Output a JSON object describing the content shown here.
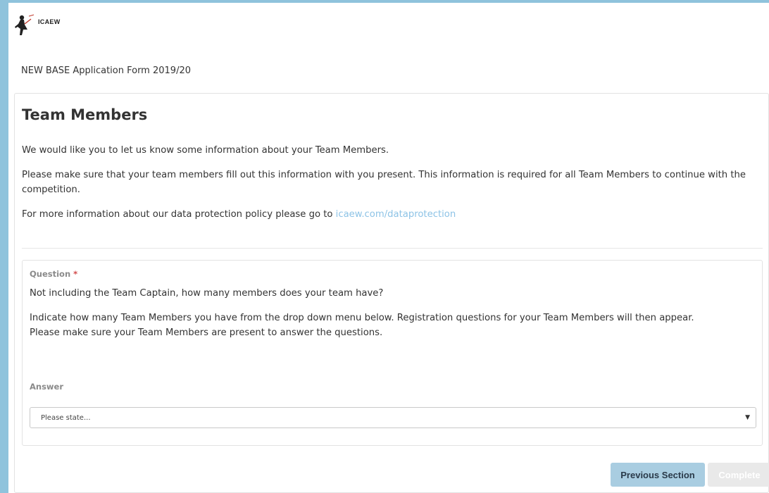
{
  "header": {
    "logo_text": "ICAEW",
    "form_title": "NEW BASE Application Form 2019/20"
  },
  "section": {
    "heading": "Team Members",
    "intro_1": "We would like you to let us know some information about your Team Members.",
    "intro_2": "Please make sure that your team members fill out this information with you present. This information is required for all Team Members to continue with the competition.",
    "intro_3_prefix": "For more information about our data protection policy please go to ",
    "intro_3_link": "icaew.com/dataprotection"
  },
  "question": {
    "label": "Question",
    "required_mark": "*",
    "text_1": "Not including the Team Captain, how many members does your team have?",
    "text_2": "Indicate how many Team Members you have from the drop down menu below. Registration questions for your Team Members will then appear.",
    "text_3": "Please make sure your Team Members are present to answer the questions.",
    "answer_label": "Answer",
    "select_value": "Please state...",
    "select_icon": "chevron-down-icon"
  },
  "footer": {
    "previous_label": "Previous Section",
    "complete_label": "Complete"
  },
  "colors": {
    "frame": "#8fc3dc",
    "link": "#8dc3e6",
    "primary_button": "#a9cde1",
    "disabled_button": "#e9e9e9",
    "required": "#d24a4a"
  }
}
